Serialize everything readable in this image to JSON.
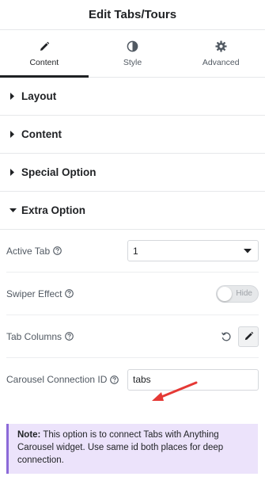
{
  "panel": {
    "title": "Edit Tabs/Tours"
  },
  "tabs": [
    {
      "label": "Content",
      "icon": "pencil-icon",
      "active": true
    },
    {
      "label": "Style",
      "icon": "half-circle-icon",
      "active": false
    },
    {
      "label": "Advanced",
      "icon": "gear-icon",
      "active": false
    }
  ],
  "sections": [
    {
      "label": "Layout",
      "expanded": false
    },
    {
      "label": "Content",
      "expanded": false
    },
    {
      "label": "Special Option",
      "expanded": false
    },
    {
      "label": "Extra Option",
      "expanded": true
    }
  ],
  "extra_option": {
    "active_tab": {
      "label": "Active Tab",
      "value": "1"
    },
    "swiper_effect": {
      "label": "Swiper Effect",
      "toggle_label": "Hide",
      "enabled": false
    },
    "tab_columns": {
      "label": "Tab Columns"
    },
    "carousel_connection": {
      "label": "Carousel Connection ID",
      "value": "tabs"
    }
  },
  "note": {
    "strong": "Note:",
    "text": " This option is to connect Tabs with Anything Carousel widget. Use same id both places for deep connection."
  },
  "colors": {
    "accent_dark": "#1f2124",
    "note_bg": "#ece3fb",
    "note_border": "#8c6ad8",
    "annotation_arrow": "#e53935"
  }
}
